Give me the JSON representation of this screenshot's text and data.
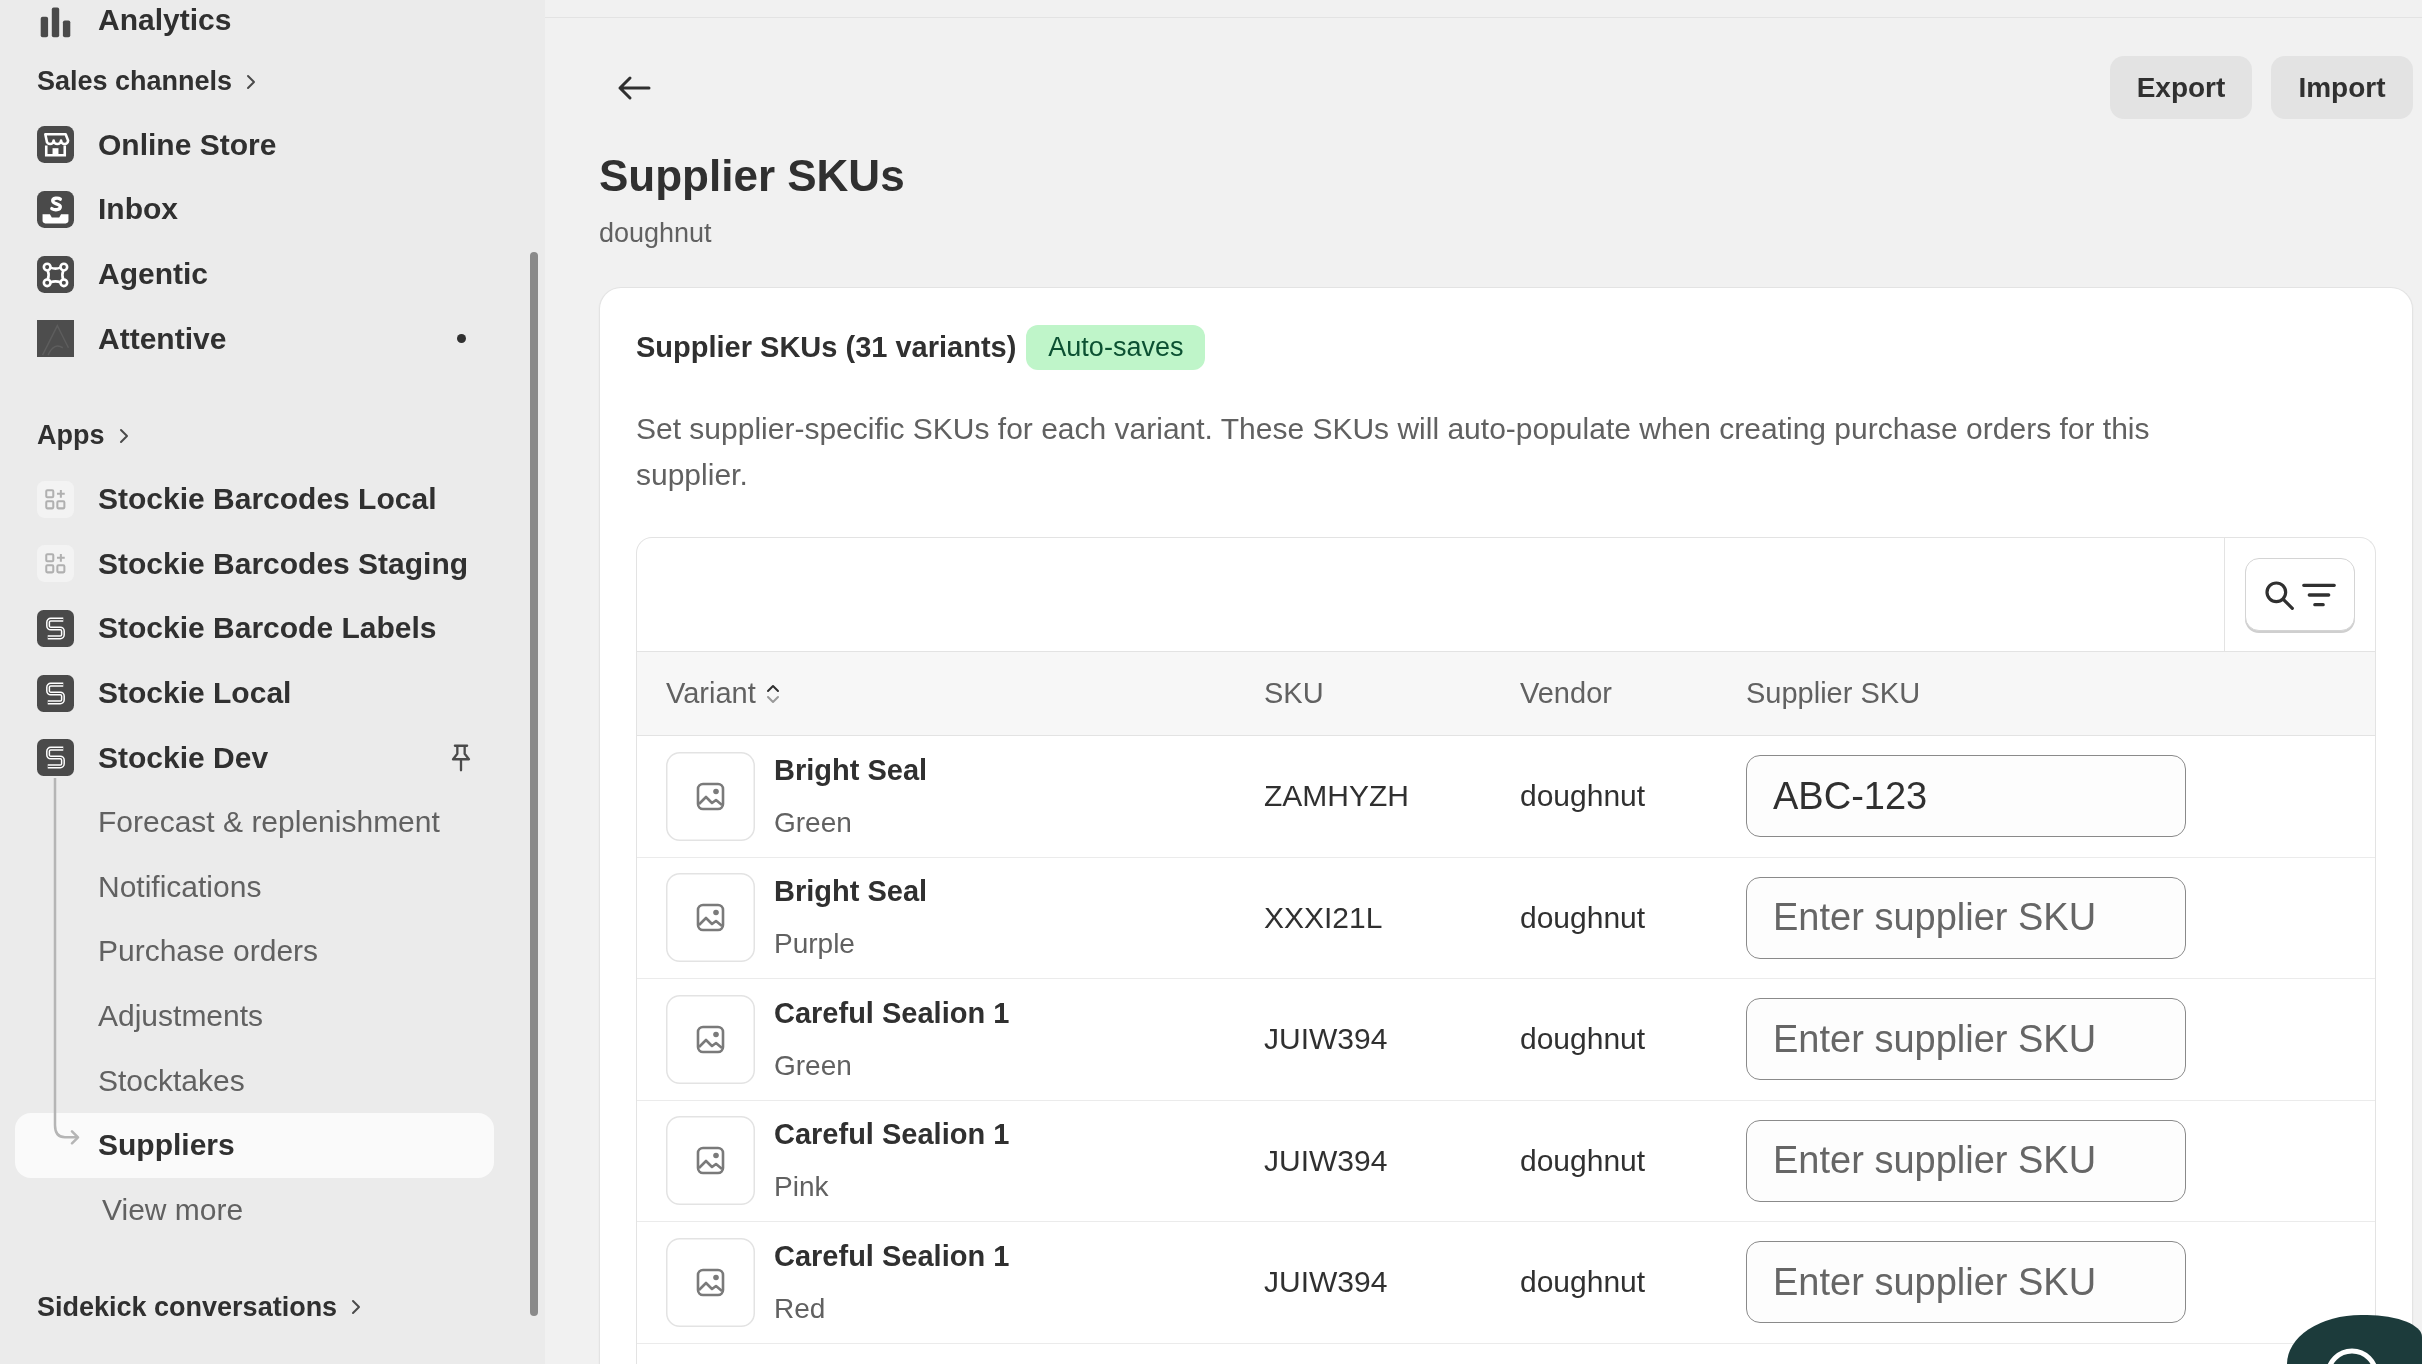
{
  "sidebar": {
    "nav_items": [
      {
        "label": "Analytics",
        "kind": "chart",
        "selected": false
      }
    ],
    "sections": [
      {
        "title": "Sales channels",
        "items": [
          {
            "label": "Online Store",
            "kind": "store",
            "selected": false,
            "dot": false,
            "pinned": false
          },
          {
            "label": "Inbox",
            "kind": "inbox",
            "selected": false,
            "dot": false,
            "pinned": false
          },
          {
            "label": "Agentic",
            "kind": "nodes",
            "selected": false,
            "dot": false,
            "pinned": false
          },
          {
            "label": "Attentive",
            "kind": "tile",
            "selected": false,
            "dot": true,
            "pinned": false
          }
        ]
      },
      {
        "title": "Apps",
        "items": [
          {
            "label": "Stockie Barcodes Local",
            "kind": "grid",
            "selected": false,
            "dot": false,
            "pinned": false
          },
          {
            "label": "Stockie Barcodes Staging",
            "kind": "grid",
            "selected": false,
            "dot": false,
            "pinned": false
          },
          {
            "label": "Stockie Barcode Labels",
            "kind": "s-logo",
            "selected": false,
            "dot": false,
            "pinned": false
          },
          {
            "label": "Stockie Local",
            "kind": "s-logo",
            "selected": false,
            "dot": false,
            "pinned": false
          },
          {
            "label": "Stockie Dev",
            "kind": "s-logo",
            "selected": false,
            "dot": false,
            "pinned": true,
            "children": [
              {
                "label": "Forecast & replenishment",
                "selected": false
              },
              {
                "label": "Notifications",
                "selected": false
              },
              {
                "label": "Purchase orders",
                "selected": false
              },
              {
                "label": "Adjustments",
                "selected": false
              },
              {
                "label": "Stocktakes",
                "selected": false
              },
              {
                "label": "Suppliers",
                "selected": true
              }
            ]
          }
        ],
        "view_more": "View more"
      },
      {
        "title": "Sidekick conversations"
      }
    ]
  },
  "header": {
    "title": "Supplier SKUs",
    "subtitle": "doughnut",
    "actions": [
      "Export",
      "Import"
    ]
  },
  "card": {
    "title": "Supplier SKUs (31 variants)",
    "badge": "Auto-saves",
    "description": "Set supplier-specific SKUs for each variant. These SKUs will auto-populate when creating purchase orders for this supplier.",
    "table": {
      "columns": [
        {
          "label": "Variant",
          "sortable": true
        },
        {
          "label": "SKU",
          "sortable": false
        },
        {
          "label": "Vendor",
          "sortable": false
        },
        {
          "label": "Supplier SKU",
          "sortable": false
        }
      ],
      "rows": [
        {
          "name": "Bright Seal",
          "option": "Green",
          "sku": "ZAMHYZH",
          "vendor": "doughnut",
          "supplier_sku": {
            "value": "ABC-123"
          }
        },
        {
          "name": "Bright Seal",
          "option": "Purple",
          "sku": "XXXI21L",
          "vendor": "doughnut",
          "supplier_sku": {
            "placeholder": "Enter supplier SKU"
          }
        },
        {
          "name": "Careful Sealion 1",
          "option": "Green",
          "sku": "JUIW394",
          "vendor": "doughnut",
          "supplier_sku": {
            "placeholder": "Enter supplier SKU"
          }
        },
        {
          "name": "Careful Sealion 1",
          "option": "Pink",
          "sku": "JUIW394",
          "vendor": "doughnut",
          "supplier_sku": {
            "placeholder": "Enter supplier SKU"
          }
        },
        {
          "name": "Careful Sealion 1",
          "option": "Red",
          "sku": "JUIW394",
          "vendor": "doughnut",
          "supplier_sku": {
            "placeholder": "Enter supplier SKU"
          }
        }
      ]
    }
  }
}
